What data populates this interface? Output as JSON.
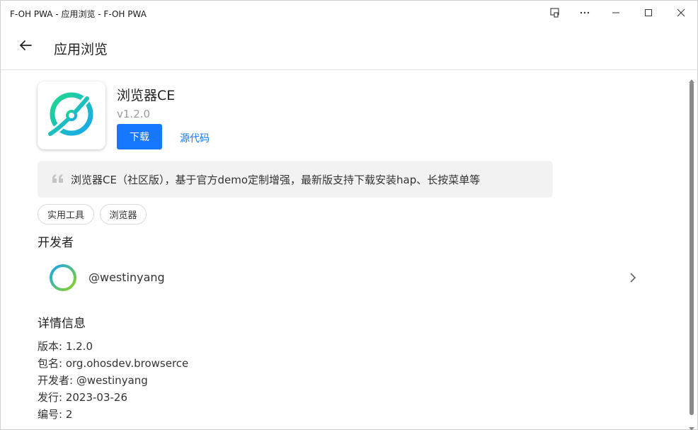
{
  "window": {
    "title": "F-OH PWA - 应用浏览 - F-OH PWA"
  },
  "appbar": {
    "title": "应用浏览"
  },
  "app": {
    "name": "浏览器CE",
    "version": "v1.2.0",
    "download_label": "下载",
    "source_label": "源代码",
    "description": "浏览器CE（社区版），基于官方demo定制增强，最新版支持下载安装hap、长按菜单等",
    "tags": [
      "实用工具",
      "浏览器"
    ]
  },
  "developer": {
    "section_title": "开发者",
    "name": "@westinyang"
  },
  "details": {
    "section_title": "详情信息",
    "lines": [
      "版本: 1.2.0",
      "包名: org.ohosdev.browserce",
      "开发者: @westinyang",
      "发行: 2023-03-26",
      "编号: 2"
    ]
  },
  "colors": {
    "accent": "#1677ff",
    "icon_gradient_start": "#1ed98a",
    "icon_gradient_end": "#1aa6f0"
  },
  "icons": {
    "back": "arrow-left-icon",
    "quote": "quote-icon",
    "chevron": "chevron-right-icon",
    "app_icon": "planet-browser-icon"
  }
}
